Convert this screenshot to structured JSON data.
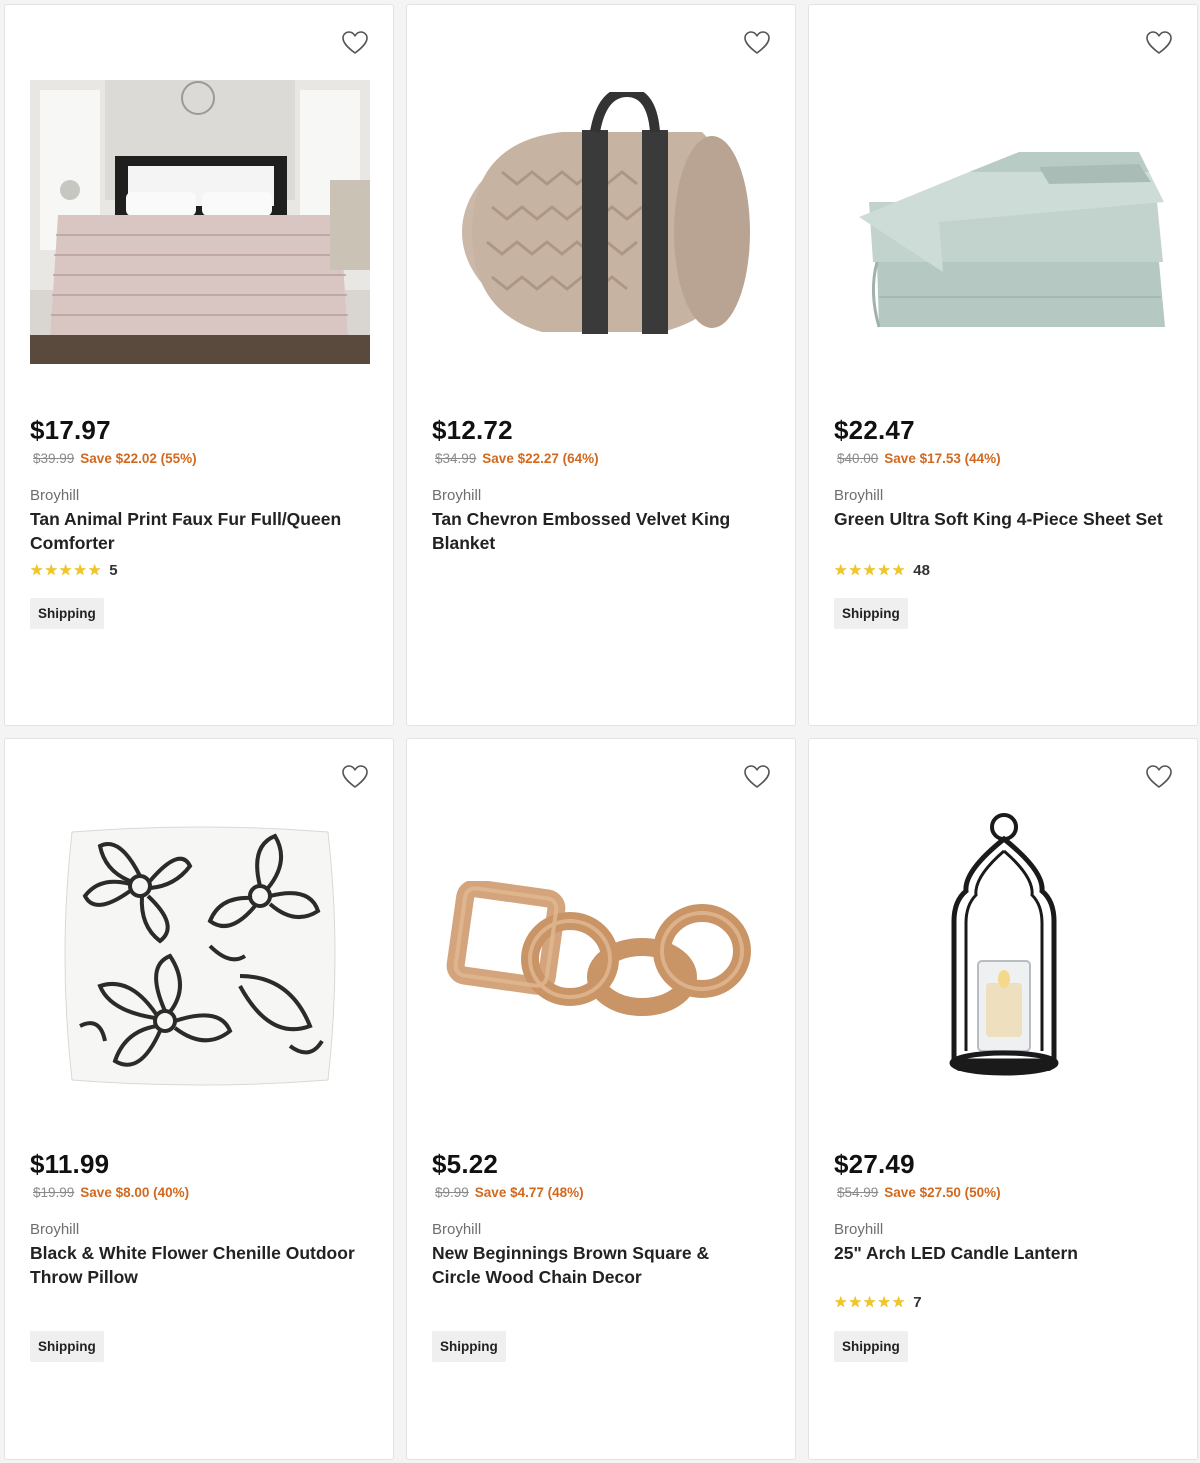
{
  "colors": {
    "save": "#d2691e",
    "star": "#f3c622",
    "was": "#8a8a8a"
  },
  "products": [
    {
      "price": "$17.97",
      "was": "$39.99",
      "save": "Save $22.02 (55%)",
      "brand": "Broyhill",
      "title": "Tan Animal Print Faux Fur Full/Queen Comforter",
      "rating_count": "5",
      "rating": 5,
      "shipping": "Shipping",
      "image": "comforter-bedroom-photo"
    },
    {
      "price": "$12.72",
      "was": "$34.99",
      "save": "Save $22.27 (64%)",
      "brand": "Broyhill",
      "title": "Tan Chevron Embossed Velvet King Blanket",
      "image": "rolled-blanket-photo"
    },
    {
      "price": "$22.47",
      "was": "$40.00",
      "save": "Save $17.53 (44%)",
      "brand": "Broyhill",
      "title": "Green Ultra Soft King 4-Piece Sheet Set",
      "rating_count": "48",
      "rating": 5,
      "shipping": "Shipping",
      "image": "folded-sheets-photo"
    },
    {
      "price": "$11.99",
      "was": "$19.99",
      "save": "Save $8.00 (40%)",
      "brand": "Broyhill",
      "title": "Black & White Flower Chenille Outdoor Throw Pillow",
      "shipping": "Shipping",
      "image": "flower-pillow-photo"
    },
    {
      "price": "$5.22",
      "was": "$9.99",
      "save": "Save $4.77 (48%)",
      "brand": "Broyhill",
      "title": "New Beginnings Brown Square & Circle Wood Chain Decor",
      "shipping": "Shipping",
      "image": "wood-chain-photo"
    },
    {
      "price": "$27.49",
      "was": "$54.99",
      "save": "Save $27.50 (50%)",
      "brand": "Broyhill",
      "title": "25\" Arch LED Candle Lantern",
      "rating_count": "7",
      "rating": 5,
      "shipping": "Shipping",
      "image": "arch-lantern-photo"
    }
  ]
}
